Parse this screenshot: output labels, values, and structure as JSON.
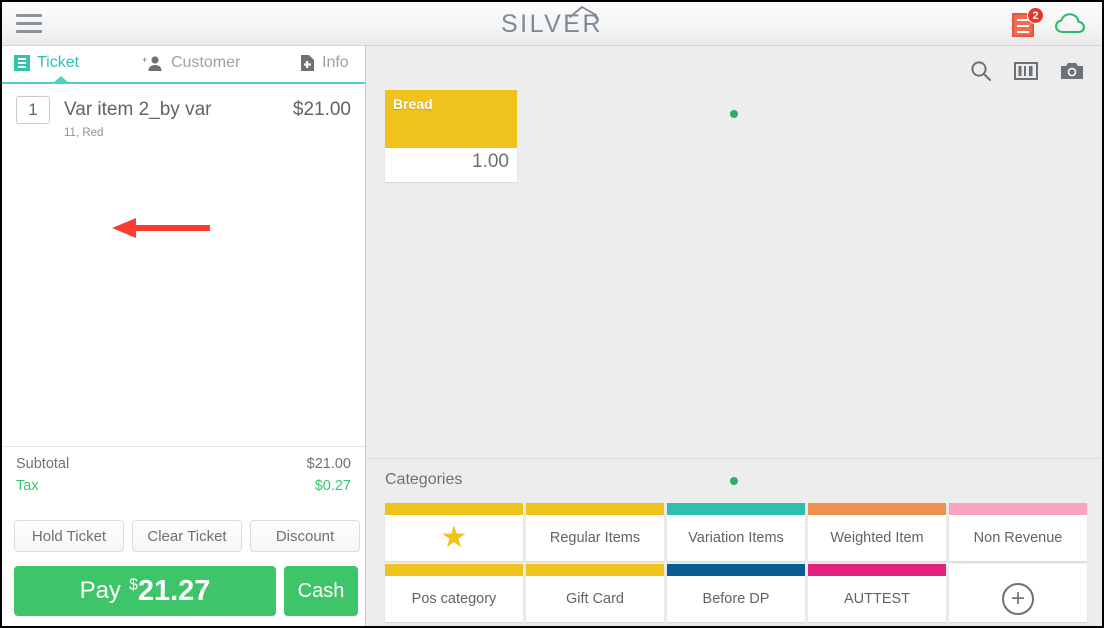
{
  "app": {
    "logo_text": "SILVER",
    "menu_icon": "hamburger-menu-icon",
    "open_tickets_badge": "2"
  },
  "left_panel": {
    "tabs": [
      {
        "label": "Ticket",
        "icon": "receipt-icon",
        "active": true
      },
      {
        "label": "Customer",
        "icon": "add-person-icon",
        "active": false
      },
      {
        "label": "Info",
        "icon": "document-add-icon",
        "active": false
      }
    ],
    "line_items": [
      {
        "qty": "1",
        "name": "Var item 2_by var",
        "price": "$21.00",
        "modifiers": "11, Red"
      }
    ],
    "totals": [
      {
        "label": "Subtotal",
        "value": "$21.00"
      },
      {
        "label": "Tax",
        "value": "$0.27"
      }
    ],
    "actions": [
      {
        "label": "Hold Ticket"
      },
      {
        "label": "Clear Ticket"
      },
      {
        "label": "Discount"
      }
    ],
    "pay": {
      "label": "Pay",
      "currency": "$",
      "amount": "21.27",
      "cash_label": "Cash"
    }
  },
  "right_panel": {
    "tools": [
      {
        "name": "search-icon"
      },
      {
        "name": "barcode-icon"
      },
      {
        "name": "camera-icon"
      }
    ],
    "items": [
      {
        "name": "Bread",
        "price": "1.00",
        "color": "#EFC21C"
      }
    ],
    "categories_title": "Categories",
    "categories": [
      {
        "label": "",
        "icon": "star-icon",
        "color": "#EFC21C"
      },
      {
        "label": "Regular Items",
        "color": "#EFC21C"
      },
      {
        "label": "Variation Items",
        "color": "#2EBFAE"
      },
      {
        "label": "Weighted Item",
        "color": "#F0904E"
      },
      {
        "label": "Non Revenue",
        "color": "#F9A3C0"
      },
      {
        "label": "Pos category",
        "color": "#EFC21C"
      },
      {
        "label": "Gift Card",
        "color": "#EFC21C"
      },
      {
        "label": "Before DP",
        "color": "#0B5C92"
      },
      {
        "label": "AUTTEST",
        "color": "#E4217C"
      },
      {
        "label": "",
        "icon": "plus-circle-icon",
        "color": ""
      }
    ]
  },
  "colors": {
    "accent_teal": "#32C3AE",
    "pay_green": "#3EC469",
    "badge_red": "#E8352A",
    "annotation_red": "#FB3B30"
  }
}
